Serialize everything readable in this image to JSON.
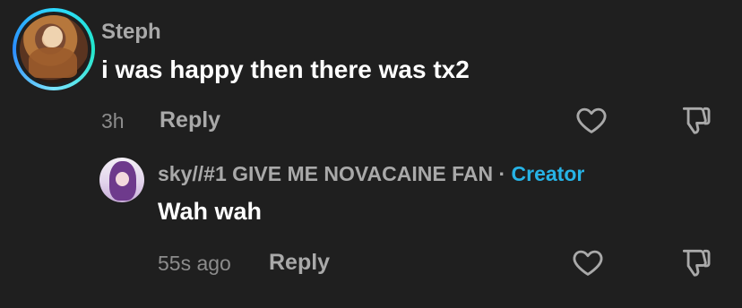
{
  "comment": {
    "author": "Steph",
    "text": "i was happy then there was tx2",
    "time": "3h",
    "reply_label": "Reply"
  },
  "reply": {
    "author": "sky//#1 GIVE ME NOVACAINE FAN",
    "separator": " · ",
    "badge": "Creator",
    "text": "Wah wah",
    "time": "55s ago",
    "reply_label": "Reply"
  },
  "colors": {
    "background": "#1f1f1f",
    "creator_badge": "#27b3e6",
    "avatar_ring": "#2dd9ff"
  },
  "icons": {
    "like": "heart-outline-icon",
    "dislike": "thumbs-down-outline-icon"
  }
}
